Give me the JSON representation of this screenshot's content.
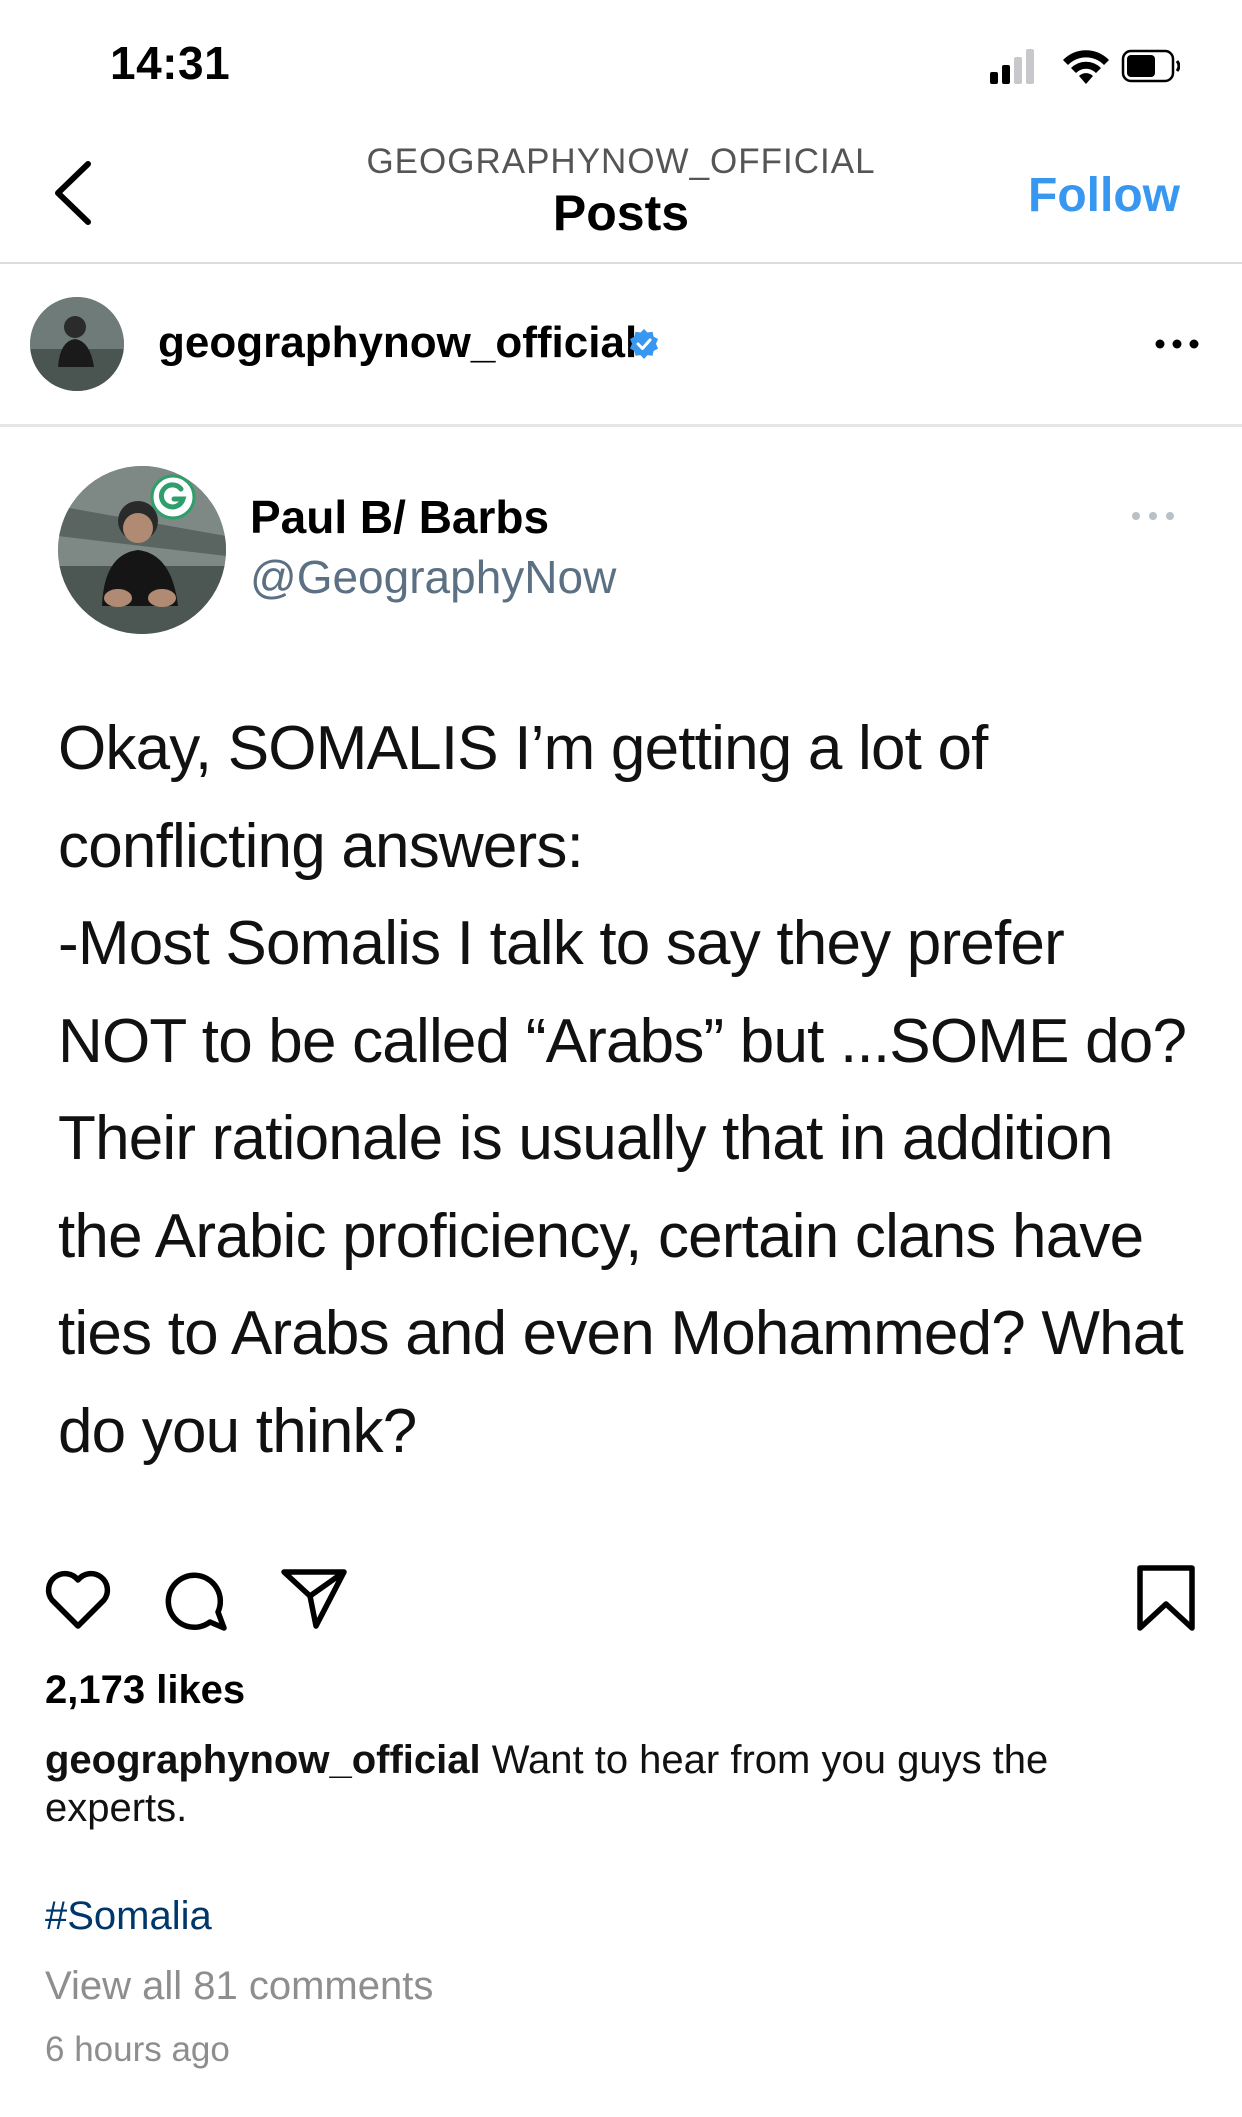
{
  "status_bar": {
    "time": "14:31",
    "icons": [
      "cellular-signal-icon",
      "wifi-icon",
      "battery-icon"
    ]
  },
  "nav": {
    "back_icon": "chevron-left-icon",
    "account": "GEOGRAPHYNOW_OFFICIAL",
    "title": "Posts",
    "follow_label": "Follow",
    "accent_color": "#3897f0"
  },
  "post": {
    "username": "geographynow_official",
    "verified_icon": "verified-badge-icon",
    "more_icon": "more-horizontal-icon",
    "tweet": {
      "name": "Paul B/ Barbs",
      "handle": "@GeographyNow",
      "text": "Okay, SOMALIS I’m getting a lot of conflicting answers:\n-Most Somalis I talk to say they prefer NOT to be called “Arabs” but ...SOME do? Their rationale is usually that in addition the Arabic proficiency, certain clans have ties to Arabs and even Mohammed? What do you think?"
    },
    "actions": [
      "heart-icon",
      "comment-icon",
      "share-icon",
      "bookmark-icon"
    ],
    "likes": "2,173 likes",
    "caption_user": "geographynow_official",
    "caption_text": " Want to hear from you guys the experts.",
    "hashtag": "#Somalia",
    "view_comments": "View all 81 comments",
    "timestamp": "6 hours ago"
  }
}
